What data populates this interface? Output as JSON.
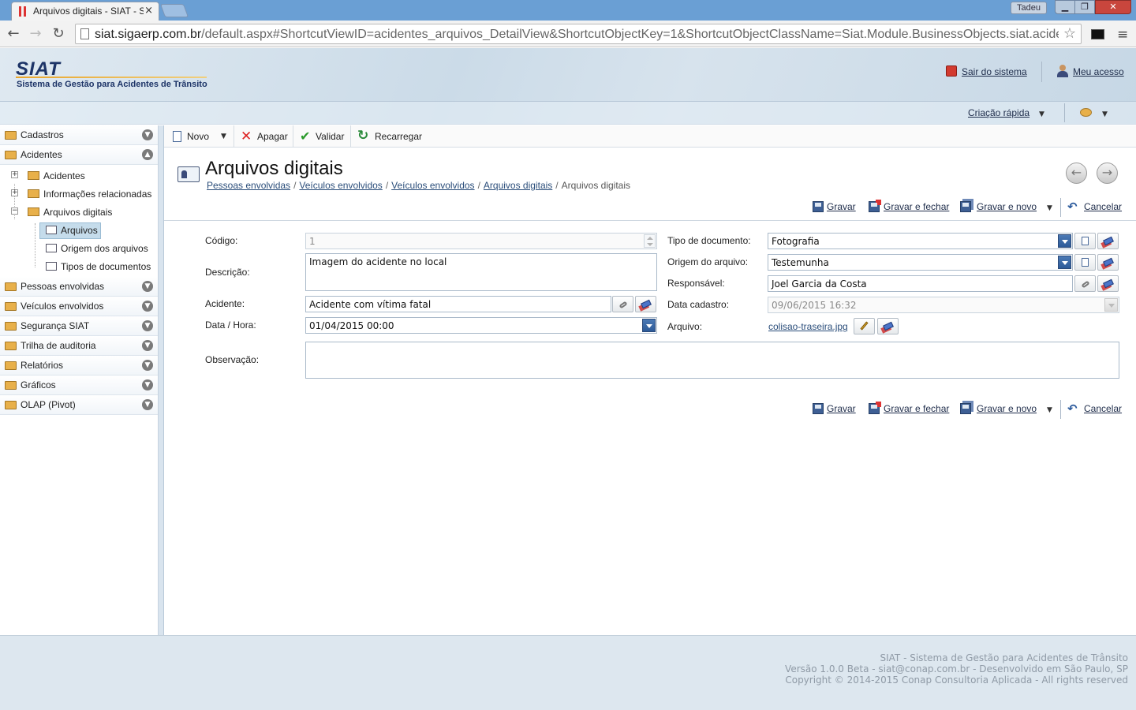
{
  "browser": {
    "tab_title": "Arquivos digitais - SIAT - S",
    "close_glyph": "×",
    "user_badge": "Tadeu",
    "url_domain": "siat.sigaerp.com.br",
    "url_path": "/default.aspx#ShortcutViewID=acidentes_arquivos_DetailView&ShortcutObjectKey=1&ShortcutObjectClassName=Siat.Module.BusinessObjects.siat.acidente",
    "back_glyph": "←",
    "forward_glyph": "→",
    "reload_glyph": "↻",
    "star_glyph": "☆",
    "menu_glyph": "≡",
    "min_glyph": "▁",
    "max_glyph": "❐",
    "close_window_glyph": "✕"
  },
  "header": {
    "logo": "SIAT",
    "subtitle": "Sistema de Gestão para Acidentes de Trânsito",
    "logout": "Sair do sistema",
    "my_access": "Meu acesso",
    "quick_create": "Criação rápida",
    "caret": "▼"
  },
  "sidebar": {
    "groups": [
      {
        "label": "Cadastros",
        "toggle": "▼"
      },
      {
        "label": "Acidentes",
        "toggle": "▲"
      },
      {
        "label": "Pessoas envolvidas",
        "toggle": "▼"
      },
      {
        "label": "Veículos envolvidos",
        "toggle": "▼"
      },
      {
        "label": "Segurança SIAT",
        "toggle": "▼"
      },
      {
        "label": "Trilha de auditoria",
        "toggle": "▼"
      },
      {
        "label": "Relatórios",
        "toggle": "▼"
      },
      {
        "label": "Gráficos",
        "toggle": "▼"
      },
      {
        "label": "OLAP (Pivot)",
        "toggle": "▼"
      }
    ],
    "tree": {
      "expand": "+",
      "collapse": "−",
      "items": [
        "Acidentes",
        "Informações relacionadas",
        "Arquivos digitais"
      ],
      "children": [
        "Arquivos",
        "Origem dos arquivos",
        "Tipos de documentos"
      ]
    }
  },
  "actions": {
    "new": "Novo",
    "delete": "Apagar",
    "validate": "Validar",
    "reload": "Recarregar",
    "caret": "▼",
    "x_glyph": "✕",
    "check_glyph": "✔",
    "refresh_glyph": "↻"
  },
  "page": {
    "title": "Arquivos digitais",
    "breadcrumb": [
      "Pessoas envolvidas",
      "Veículos envolvidos",
      "Veículos envolvidos",
      "Arquivos digitais"
    ],
    "breadcrumb_current": "Arquivos digitais",
    "breadcrumb_sep": "/",
    "prev_glyph": "←",
    "next_glyph": "→"
  },
  "savebar": {
    "save": "Gravar",
    "save_close": "Gravar e fechar",
    "save_new": "Gravar e novo",
    "cancel": "Cancelar",
    "caret": "▼",
    "undo_glyph": "↶"
  },
  "form": {
    "codigo_label": "Código:",
    "codigo_value": "1",
    "descricao_label": "Descrição:",
    "descricao_value": "Imagem do acidente no local",
    "acidente_label": "Acidente:",
    "acidente_value": "Acidente com vítima fatal",
    "datahora_label": "Data / Hora:",
    "datahora_value": "01/04/2015 00:00",
    "observacao_label": "Observação:",
    "observacao_value": "",
    "tipo_label": "Tipo de documento:",
    "tipo_value": "Fotografia",
    "origem_label": "Origem do arquivo:",
    "origem_value": "Testemunha",
    "responsavel_label": "Responsável:",
    "responsavel_value": "Joel Garcia da Costa",
    "datacadastro_label": "Data cadastro:",
    "datacadastro_value": "09/06/2015 16:32",
    "arquivo_label": "Arquivo:",
    "arquivo_value": "colisao-traseira.jpg"
  },
  "footer": {
    "line1": "SIAT - Sistema de Gestão para Acidentes de Trânsito",
    "line2": "Versão 1.0.0 Beta - siat@conap.com.br - Desenvolvido em São Paulo, SP",
    "line3": "Copyright © 2014-2015 Conap Consultoria Aplicada - All rights reserved"
  }
}
